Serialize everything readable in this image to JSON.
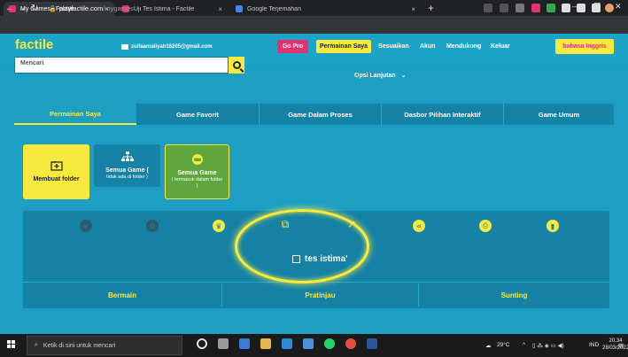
{
  "browser": {
    "tabs": [
      {
        "title": "My Games - Factile",
        "active": true
      },
      {
        "title": "Uji Tes Istima - Factile",
        "active": false
      },
      {
        "title": "Google Terjemahan",
        "active": false
      }
    ],
    "close_glyph": "×",
    "new_tab": "+",
    "url_host": "playfactile.com",
    "url_path": "/mygames"
  },
  "header": {
    "logo": "factile",
    "email": "zulfaamaliyah16205@gmail.com",
    "go_pro": "Go Pro",
    "my_games": "Permainan Saya",
    "links": [
      "Sesuaikan",
      "Akun",
      "Mendukung",
      "Keluar"
    ],
    "language": "bahasa Inggris"
  },
  "search": {
    "placeholder": "Mencari",
    "more_options": "Opsi Lanjutan",
    "more_options_chevron": "⌄"
  },
  "tabs": [
    "Permainan Saya",
    "Game Favorit",
    "Game Dalam Proses",
    "Dasbor Pilihan Interaktif",
    "Game Umum"
  ],
  "folders": {
    "create": "Membuat folder",
    "all_games": "Semua Game (",
    "all_games_sub": "tidak ada di folder )",
    "all_games_inc": "Semua Game",
    "all_games_inc_sub": "( termasuk dalam folder )"
  },
  "game": {
    "title": "tes istima'",
    "actions": [
      "Bermain",
      "Pratinjau",
      "Sunting"
    ]
  },
  "taskbar": {
    "search_placeholder": "Ketik di sini untuk mencari",
    "weather": "29°C",
    "lang": "IND",
    "time": "20.34",
    "date": "28/03/2022"
  },
  "colors": {
    "accent_yellow": "#f7ea3d",
    "pink": "#e53170",
    "main_blue": "#1d9fc4",
    "dark_blue": "#1582a6",
    "green": "#5fa63d"
  }
}
